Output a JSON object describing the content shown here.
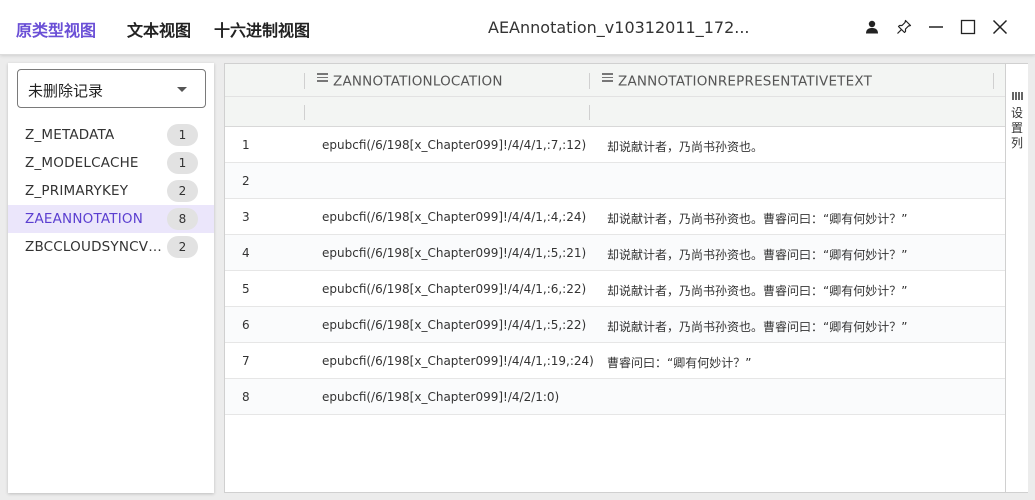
{
  "tabs": [
    {
      "label": "原类型视图",
      "active": true
    },
    {
      "label": "文本视图",
      "active": false
    },
    {
      "label": "十六进制视图",
      "active": false
    }
  ],
  "window": {
    "title": "AEAnnotation_v10312011_172...",
    "icons": [
      "user-icon",
      "pin-icon",
      "minimize-icon",
      "maximize-icon",
      "close-icon"
    ]
  },
  "sidebar": {
    "select_value": "未删除记录",
    "tables": [
      {
        "name": "Z_METADATA",
        "count": "1"
      },
      {
        "name": "Z_MODELCACHE",
        "count": "1"
      },
      {
        "name": "Z_PRIMARYKEY",
        "count": "2"
      },
      {
        "name": "ZAEANNOTATION",
        "count": "8"
      },
      {
        "name": "ZBCCLOUDSYNCVE...",
        "count": "2"
      }
    ],
    "selected_index": 3
  },
  "grid": {
    "columns": [
      "ZANNOTATIONLOCATION",
      "ZANNOTATIONREPRESENTATIVETEXT"
    ],
    "rows": [
      {
        "num": "1",
        "location": "epubcfi(/6/198[x_Chapter099]!/4/4/1,:7,:12)",
        "text": "却说献计者，乃尚书孙资也。"
      },
      {
        "num": "2",
        "location": "",
        "text": ""
      },
      {
        "num": "3",
        "location": "epubcfi(/6/198[x_Chapter099]!/4/4/1,:4,:24)",
        "text": "却说献计者，乃尚书孙资也。曹睿问曰：“卿有何妙计？”"
      },
      {
        "num": "4",
        "location": "epubcfi(/6/198[x_Chapter099]!/4/4/1,:5,:21)",
        "text": "却说献计者，乃尚书孙资也。曹睿问曰：“卿有何妙计？”"
      },
      {
        "num": "5",
        "location": "epubcfi(/6/198[x_Chapter099]!/4/4/1,:6,:22)",
        "text": "却说献计者，乃尚书孙资也。曹睿问曰：“卿有何妙计？”"
      },
      {
        "num": "6",
        "location": "epubcfi(/6/198[x_Chapter099]!/4/4/1,:5,:22)",
        "text": "却说献计者，乃尚书孙资也。曹睿问曰：“卿有何妙计？”"
      },
      {
        "num": "7",
        "location": "epubcfi(/6/198[x_Chapter099]!/4/4/1,:19,:24)",
        "text": "曹睿问曰：“卿有何妙计？”"
      },
      {
        "num": "8",
        "location": "epubcfi(/6/198[x_Chapter099]!/4/2/1:0)",
        "text": ""
      }
    ],
    "side_tool_label": "设置列"
  },
  "colors": {
    "accent": "#6a4fd6",
    "selected_bg": "#ebe6fb",
    "badge_bg": "#e2e2e2",
    "header_bg": "#f3f5f3"
  }
}
